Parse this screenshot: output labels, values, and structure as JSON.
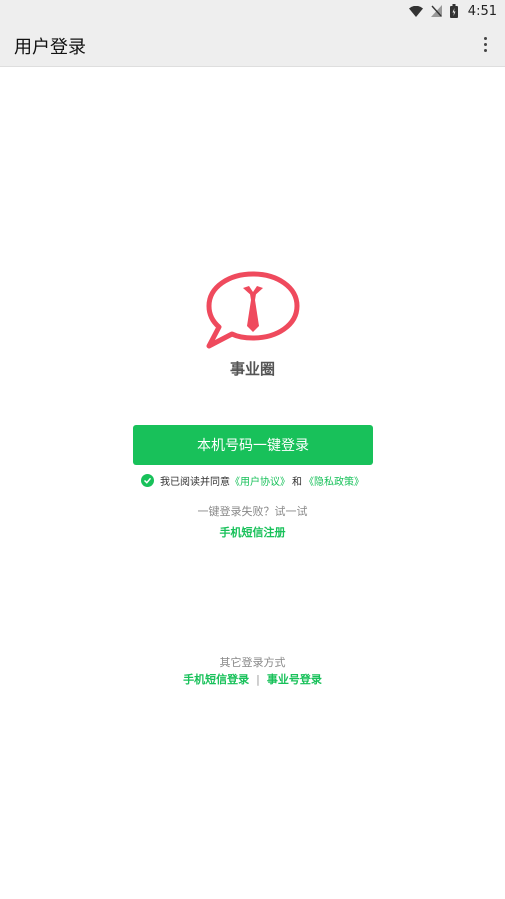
{
  "status_bar": {
    "time": "4:51"
  },
  "app_bar": {
    "title": "用户登录"
  },
  "brand": {
    "name": "事业圈",
    "logo_color": "#ef4a5d"
  },
  "primary_button": {
    "label": "本机号码一键登录",
    "color": "#18c15a"
  },
  "agreement": {
    "prefix": "我已阅读并同意",
    "user_agreement": "《用户协议》",
    "and": "和",
    "privacy_policy": "《隐私政策》",
    "checked": true
  },
  "fallback": {
    "prompt": "一键登录失败？试一试",
    "sms_register": "手机短信注册"
  },
  "other_login": {
    "title": "其它登录方式",
    "sms_login": "手机短信登录",
    "separator": "|",
    "career_login": "事业号登录"
  }
}
